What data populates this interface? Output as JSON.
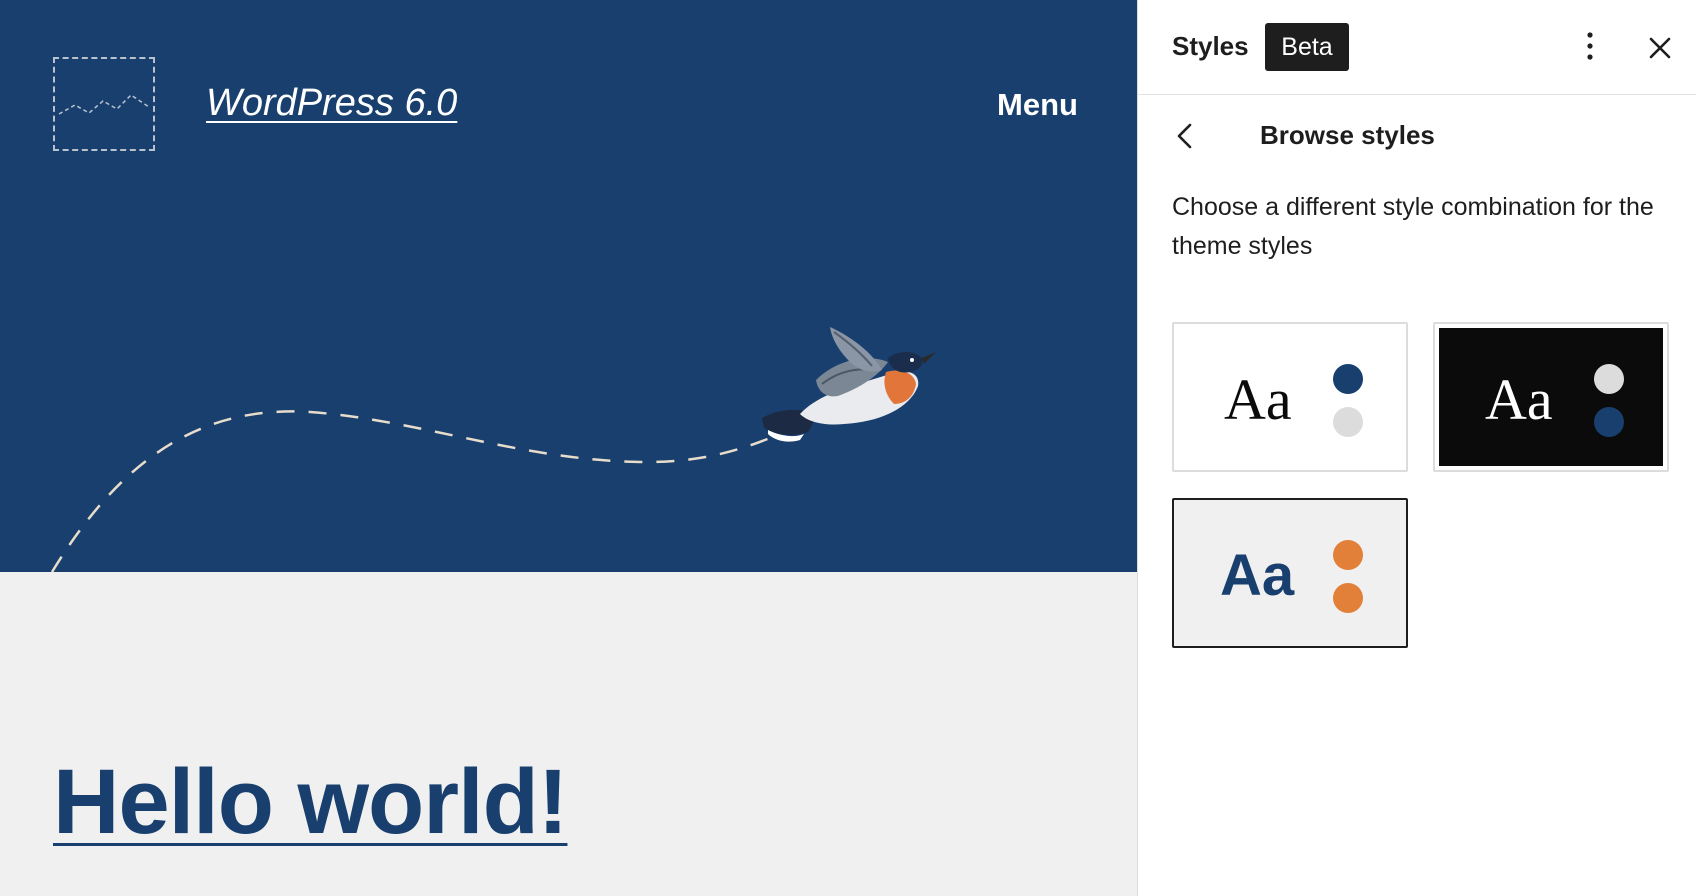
{
  "site": {
    "title": "WordPress 6.0",
    "menu_label": "Menu",
    "post_title": "Hello world!"
  },
  "sidebar": {
    "title": "Styles",
    "badge": "Beta",
    "more_icon": "more-vertical-icon",
    "close_icon": "close-icon",
    "back_icon": "chevron-left-icon",
    "heading": "Browse styles",
    "description": "Choose a different style combination for the theme styles",
    "variations": [
      {
        "sample": "Aa",
        "background": "#ffffff",
        "text_color": "#0b0b0b",
        "dots": [
          "#183f6e",
          "#dcdcdc"
        ],
        "selected": false
      },
      {
        "sample": "Aa",
        "background": "#0b0b0b",
        "text_color": "#ffffff",
        "dots": [
          "#dcdcdc",
          "#183f6e"
        ],
        "selected": false
      },
      {
        "sample": "Aa",
        "background": "#f0f0f0",
        "text_color": "#183f6e",
        "dots": [
          "#e2803a",
          "#e2803a"
        ],
        "selected": true
      }
    ]
  },
  "colors": {
    "hero_blue": "#183f6e",
    "canvas_bg": "#f0f0f0",
    "accent_orange": "#e2803a"
  }
}
